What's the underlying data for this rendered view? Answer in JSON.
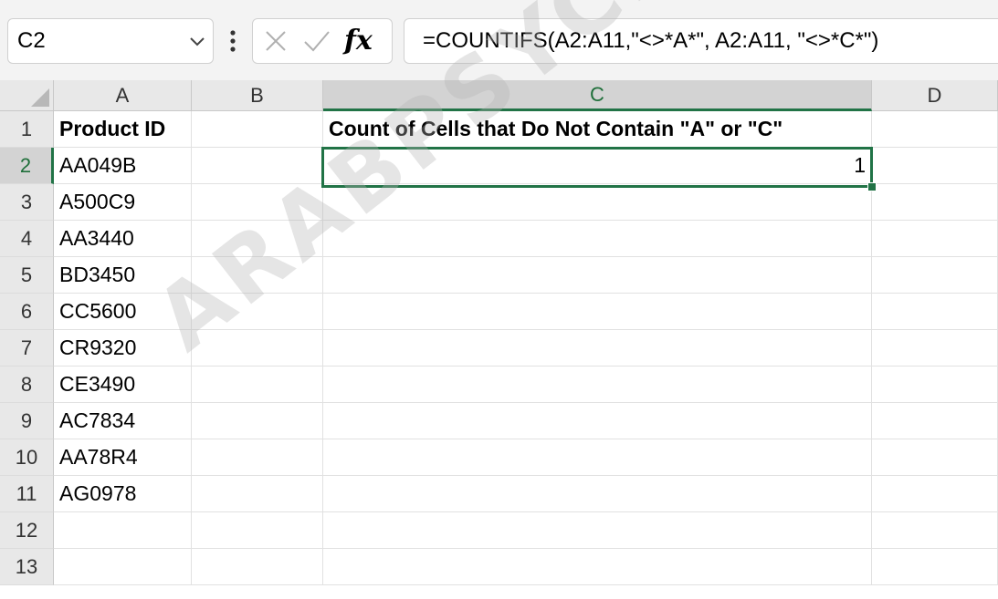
{
  "name_box": {
    "value": "C2"
  },
  "formula_bar": {
    "formula": "=COUNTIFS(A2:A11,\"<>*A*\", A2:A11, \"<>*C*\")",
    "fx_label": "fx"
  },
  "columns": [
    "A",
    "B",
    "C",
    "D"
  ],
  "rows": [
    "1",
    "2",
    "3",
    "4",
    "5",
    "6",
    "7",
    "8",
    "9",
    "10",
    "11",
    "12",
    "13"
  ],
  "cells": {
    "A1": "Product ID",
    "C1": "Count of Cells that Do Not Contain \"A\" or \"C\"",
    "C2": "1",
    "A2": "AA049B",
    "A3": "A500C9",
    "A4": "AA3440",
    "A5": "BD3450",
    "A6": "CC5600",
    "A7": "CR9320",
    "A8": "CE3490",
    "A9": "AC7834",
    "A10": "AA78R4",
    "A11": "AG0978"
  },
  "watermark": "ARABPSYCHO",
  "colors": {
    "accent": "#217346"
  }
}
